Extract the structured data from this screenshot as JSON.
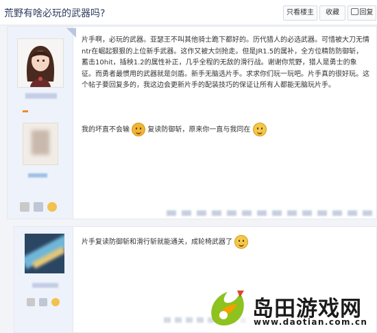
{
  "thread": {
    "title": "荒野有啥必玩的武器吗?",
    "buttons": {
      "only_op": "只看楼主",
      "favorite": "收藏",
      "reply": "回复"
    }
  },
  "posts": [
    {
      "content": "片手啊，必玩的武器。亚瑟王不叫其他骑士跪下都好的。历代猎人的必选武器。可惜被大刀无情ntr在崛起狠狠的上位新手武器。这作又被大剑抢走。但是JR1.5的属补，全方位精防防御斩，蓄击10hit，插秧1.2的属性补正，几乎全程的无敌的滑行战。谢谢你荒野，猎人是勇士的象征。而勇者最惯用的武器就是剑盾。新手无脑选片手。求求你们玩一玩吧。片手真的很好玩。这个帖子要回复多的，我这边会更新片手的配装技巧的保证让所有人都能无脑玩片手。",
      "line2_a": "我的坏直不会输",
      "line2_b": "复读防御斩，原来你一直与我同在",
      "emoji_1": "angry-face-emoji",
      "emoji_2": "smile-face-emoji"
    },
    {
      "content": "片手复读防御斩和滑行斩就能通关，成轮椅武器了",
      "emoji_1": "smile-face-emoji"
    }
  ],
  "watermark": {
    "name": "岛田游戏网",
    "url": "www.daotian.com.cn"
  },
  "colors": {
    "accent_blue": "#2d3b5e",
    "sidebar_bg": "#eef2fa",
    "logo_green": "#8dc21f",
    "logo_orange": "#f4a000"
  }
}
